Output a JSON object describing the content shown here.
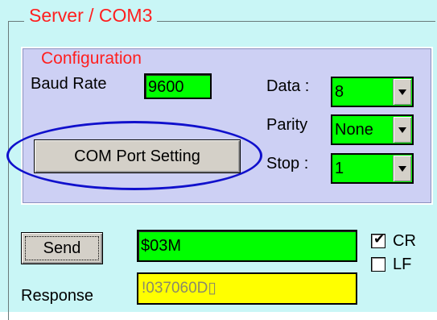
{
  "window": {
    "group_title": "Server / COM3"
  },
  "configuration": {
    "title": "Configuration",
    "baud_rate_label": "Baud Rate",
    "baud_rate_value": "9600",
    "data_label": "Data :",
    "data_value": "8",
    "parity_label": "Parity",
    "parity_value": "None",
    "stop_label": "Stop :",
    "stop_value": "1",
    "com_port_button": "COM Port Setting"
  },
  "command": {
    "send_label": "Send",
    "command_value": "$03M",
    "response_label": "Response",
    "response_value": "!037060D▯",
    "cr_label": "CR",
    "cr_checked": true,
    "lf_label": "LF",
    "lf_checked": false
  },
  "colors": {
    "field_bg": "#00ff00",
    "response_bg": "#ffff00",
    "title_text": "#ff1f1f",
    "panel_bg": "#c9f6f6",
    "config_bg": "#cdd0f4",
    "highlight_ellipse": "#1010cc"
  },
  "icons": {
    "dropdown": "chevron-down-icon",
    "checkbox": "checkmark-icon"
  }
}
